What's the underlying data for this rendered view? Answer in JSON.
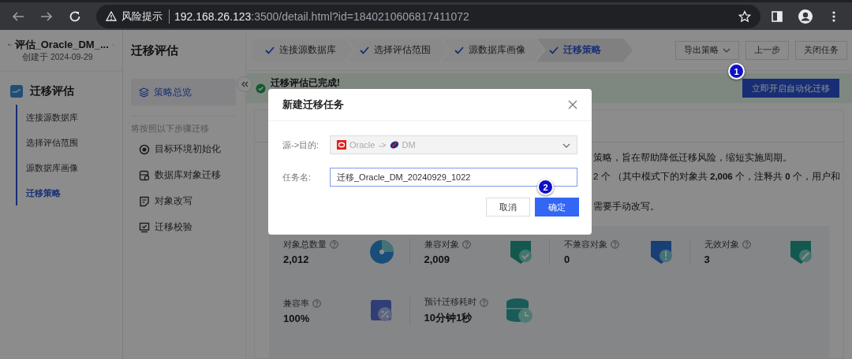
{
  "browser": {
    "warning_label": "风险提示",
    "url_host": "192.168.26.123",
    "url_rest": ":3500/detail.html?id=1840210606817411072"
  },
  "sidebar": {
    "task_title": "评估_Oracle_DM_...",
    "created": "创建于 2024-09-29",
    "section_title": "迁移评估",
    "items": [
      {
        "label": "连接源数据库",
        "selected": false
      },
      {
        "label": "选择评估范围",
        "selected": false
      },
      {
        "label": "源数据库画像",
        "selected": false
      },
      {
        "label": "迁移策略",
        "selected": true
      }
    ]
  },
  "header": {
    "title": "迁移评估",
    "steps": [
      {
        "label": "连接源数据库",
        "done": true,
        "selected": false
      },
      {
        "label": "选择评估范围",
        "done": true,
        "selected": false
      },
      {
        "label": "源数据库画像",
        "done": true,
        "selected": false
      },
      {
        "label": "迁移策略",
        "done": true,
        "selected": true
      }
    ],
    "actions": [
      {
        "label": "导出策略",
        "kind": "dropdown"
      },
      {
        "label": "上一步",
        "kind": "plain"
      },
      {
        "label": "关闭任务",
        "kind": "plain"
      }
    ]
  },
  "strategy_nav": {
    "overview": {
      "label": "策略总览",
      "selected": true
    },
    "steps_heading": "将按照以下步骤迁移",
    "items": [
      {
        "label": "目标环境初始化",
        "kind": "target"
      },
      {
        "label": "数据库对象迁移",
        "kind": "database"
      },
      {
        "label": "对象改写",
        "kind": "rewrite"
      },
      {
        "label": "迁移校验",
        "kind": "verify"
      }
    ]
  },
  "banner": {
    "message": "迁移评估已完成!",
    "primary_button": "立即开启自动化迁移",
    "marker": "1"
  },
  "summary": {
    "lines": [
      "策略，旨在帮助降低迁移风险，缩短实施周期。",
      "2 个 （其中模式下的对象共 **2,006** 个，注释共 **0** 个，用户和",
      "需要手动改写。"
    ]
  },
  "stats": [
    [
      {
        "label": "对象总数量",
        "value": "2,012",
        "kind": "pie"
      },
      {
        "label": "兼容对象",
        "value": "2,009",
        "kind": "check"
      },
      {
        "label": "不兼容对象",
        "value": "0",
        "kind": "alert"
      },
      {
        "label": "无效对象",
        "value": "3",
        "kind": "edit"
      }
    ],
    [
      {
        "label": "兼容率",
        "value": "100%",
        "kind": "percent"
      },
      {
        "label": "预计迁移耗时",
        "value": "10分钟1秒",
        "kind": "clock"
      }
    ]
  ],
  "dialog": {
    "title": "新建迁移任务",
    "fields": [
      {
        "label": "源->目的:",
        "kind": "select",
        "source": "Oracle",
        "arrow": "->",
        "target": "DM",
        "disabled": true
      },
      {
        "label": "任务名:",
        "kind": "input",
        "value": "迁移_Oracle_DM_20240929_1022",
        "focused": true
      }
    ],
    "buttons": [
      {
        "label": "取消",
        "kind": "secondary"
      },
      {
        "label": "确定",
        "kind": "primary",
        "marker": "2"
      }
    ]
  }
}
